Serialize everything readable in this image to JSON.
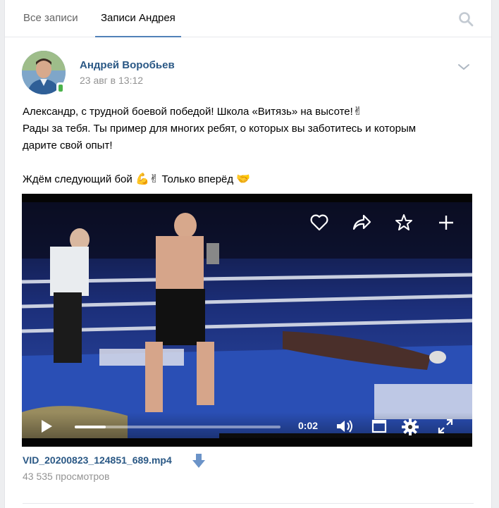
{
  "tabs": [
    {
      "label": "Все записи",
      "active": false
    },
    {
      "label": "Записи Андрея",
      "active": true
    }
  ],
  "post": {
    "author": "Андрей Воробьев",
    "date": "23 авг в 13:12",
    "text_lines": [
      "Александр, с трудной боевой победой! Школа «Витязь» на высоте!",
      "Рады за тебя. Ты пример для многих ребят, о которых вы заботитесь и которым",
      "дарите свой опыт!",
      "Ждём следующий бой",
      "Только вперёд"
    ],
    "emojis": {
      "victory": "✌",
      "muscle": "💪",
      "handshake": "🤝"
    }
  },
  "video": {
    "time": "0:02",
    "progress": 0.15,
    "actions": [
      "heart-icon",
      "share-icon",
      "star-icon",
      "plus-icon"
    ],
    "controls": [
      "play-icon",
      "volume-icon",
      "miniplayer-icon",
      "settings-icon",
      "fullscreen-icon"
    ]
  },
  "attachment": {
    "filename": "VID_20200823_124851_689.mp4",
    "views": "43 535 просмотров"
  },
  "colors": {
    "link": "#2a5885",
    "accent": "#5181b8",
    "muted": "#939393",
    "online": "#4bb34b"
  }
}
